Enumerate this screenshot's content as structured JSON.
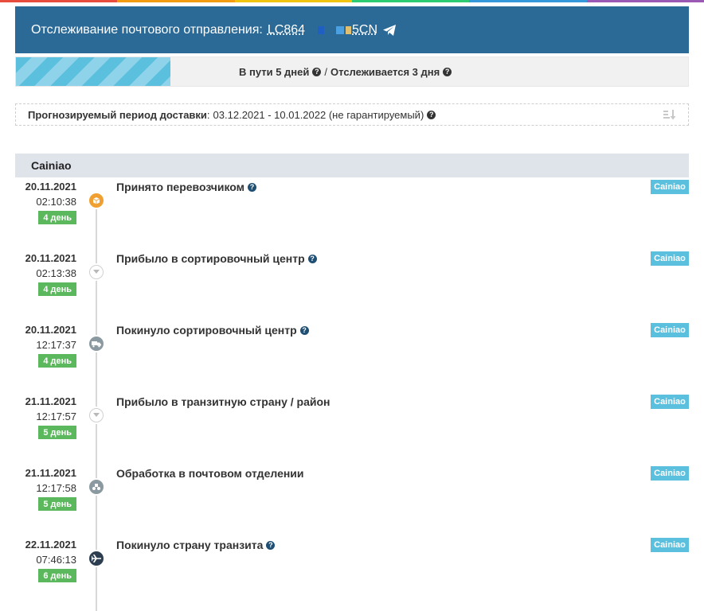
{
  "colors": {
    "header_bg": "#2b6a96",
    "progress_stripe": "#5bc0de",
    "day_badge": "#5cb85c",
    "carrier_badge": "#5bc0de",
    "carrier_header_bg": "#dfe3ea",
    "accent_orange": "#f0a030",
    "top_strip": [
      "#e74c3c",
      "#f39c12",
      "#f1c40f",
      "#2ecc71",
      "#3498db",
      "#9b59b6"
    ]
  },
  "header": {
    "title": "Отслеживание почтового отправления:",
    "tracking_prefix": "LC864",
    "tracking_suffix": "5CN",
    "telegram_icon": "telegram-icon"
  },
  "progress": {
    "fill_fraction": 0.23,
    "in_transit": "В пути 5 дней",
    "separator": "/",
    "tracked": "Отслеживается 3 дня"
  },
  "forecast": {
    "label": "Прогнозируемый период доставки",
    "colon": ":",
    "value": "03.12.2021 - 10.01.2022 (не гарантируемый)",
    "sort_icon": "sort-icon"
  },
  "carrier": {
    "name": "Cainiao"
  },
  "events": [
    {
      "date": "20.11.2021",
      "time": "02:10:38",
      "day": "4 день",
      "title": "Принято перевозчиком",
      "help": true,
      "badge": "Cainiao",
      "icon": "box-icon",
      "marker_color": "#f0a030"
    },
    {
      "date": "20.11.2021",
      "time": "02:13:38",
      "day": "4 день",
      "title": "Прибыло в сортировочный центр",
      "help": true,
      "badge": "Cainiao",
      "icon": "arrow-down-icon",
      "marker_color": "#ffffff"
    },
    {
      "date": "20.11.2021",
      "time": "12:17:37",
      "day": "4 день",
      "title": "Покинуло сортировочный центр",
      "help": true,
      "badge": "Cainiao",
      "icon": "truck-icon",
      "marker_color": "#8a9aa0"
    },
    {
      "date": "21.11.2021",
      "time": "12:17:57",
      "day": "5 день",
      "title": "Прибыло в транзитную страну / район",
      "help": false,
      "badge": "Cainiao",
      "icon": "arrow-down-icon",
      "marker_color": "#ffffff"
    },
    {
      "date": "21.11.2021",
      "time": "12:17:58",
      "day": "5 день",
      "title": "Обработка в почтовом отделении",
      "help": false,
      "badge": "Cainiao",
      "icon": "post-processing-icon",
      "marker_color": "#8a9aa0"
    },
    {
      "date": "22.11.2021",
      "time": "07:46:13",
      "day": "6 день",
      "title": "Покинуло страну транзита",
      "help": true,
      "badge": "Cainiao",
      "icon": "airplane-icon",
      "marker_color": "#2c3e50"
    }
  ]
}
